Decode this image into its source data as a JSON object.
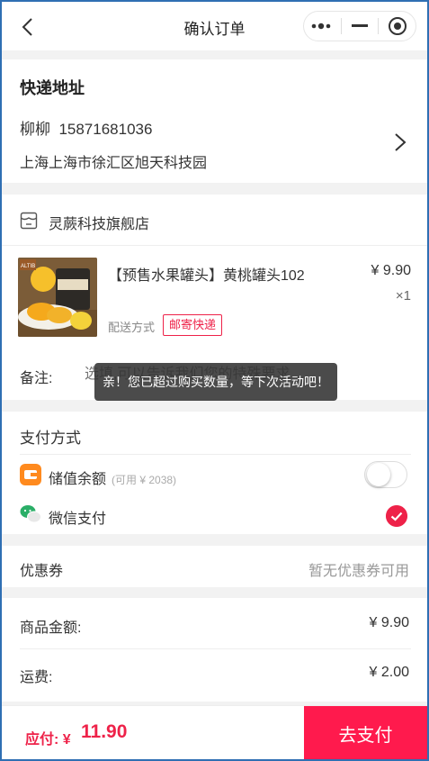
{
  "header": {
    "title": "确认订单",
    "back_icon": "chevron-left-icon",
    "capsule_icons": [
      "more-dots-icon",
      "minimize-icon",
      "target-icon"
    ]
  },
  "address": {
    "title": "快递地址",
    "name_phone": "柳柳  15871681036",
    "detail": "上海上海市徐汇区旭天科技园"
  },
  "store": {
    "name": "灵蕨科技旗舰店"
  },
  "product": {
    "title": "【预售水果罐头】黄桃罐头102",
    "price": "¥ 9.90",
    "qty": "×1",
    "shipping_label": "配送方式",
    "shipping_tag": "邮寄快递",
    "image_brand_text": "ALTIB"
  },
  "remark": {
    "label": "备注:",
    "placeholder": "选填,可以告诉我们您的特殊要求"
  },
  "toast": "亲！您已超过购买数量，等下次活动吧！",
  "payment": {
    "title": "支付方式",
    "balance_label": "储值余额",
    "balance_sub": "(可用 ¥ 2038)",
    "balance_enabled": false,
    "wechat_label": "微信支付",
    "wechat_selected": true
  },
  "coupon": {
    "label": "优惠券",
    "value": "暂无优惠券可用"
  },
  "summary": {
    "goods_label": "商品金额:",
    "goods_value": "¥ 9.90",
    "freight_label": "运费:",
    "freight_value": "¥ 2.00"
  },
  "footer": {
    "total_label": "应付: ¥",
    "total_value": "11.90",
    "pay_button": "去支付"
  },
  "colors": {
    "accent": "#ee2249",
    "pay_button": "#ff1a4d"
  }
}
